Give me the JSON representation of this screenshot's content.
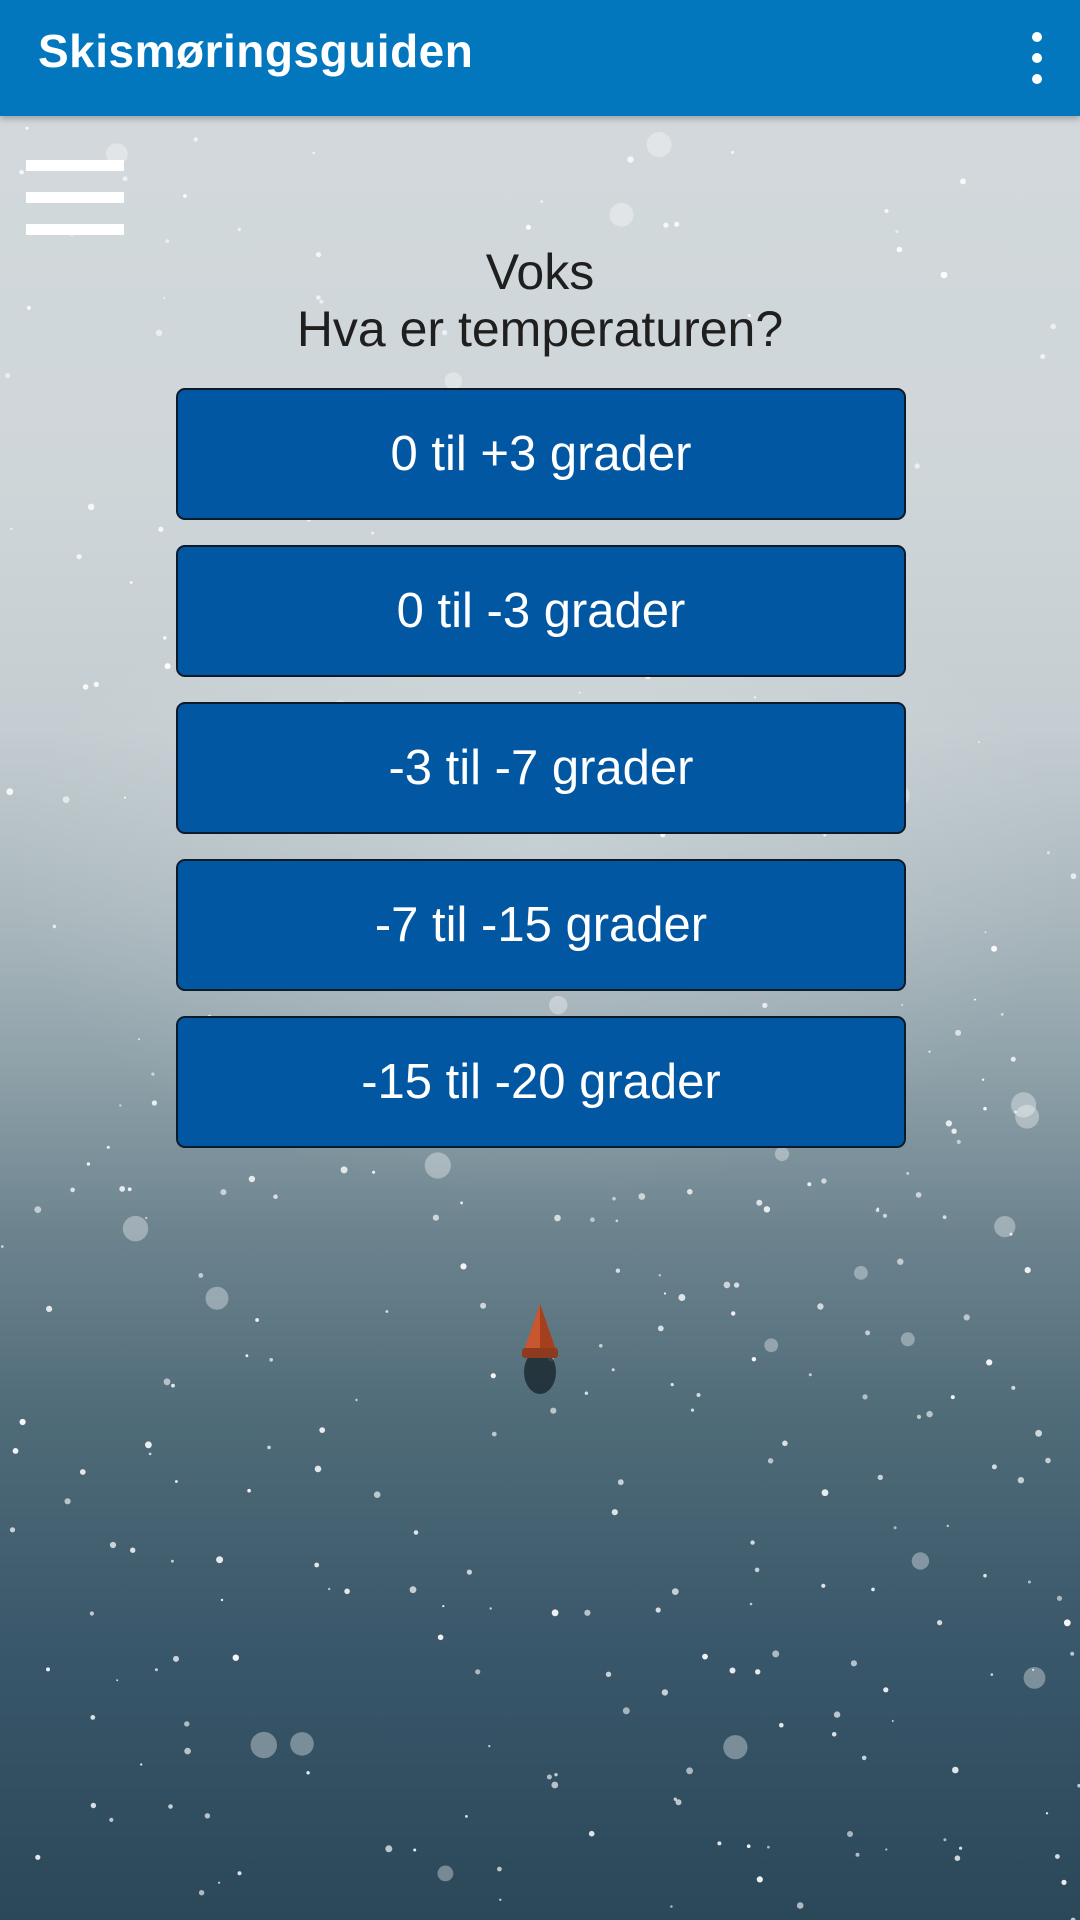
{
  "app_bar": {
    "title": "Skismøringsguiden",
    "overflow_icon": "more-vert-icon",
    "color": "#0277bd"
  },
  "nav": {
    "menu_icon": "hamburger-menu-icon"
  },
  "question": {
    "title": "Voks",
    "subtitle": "Hva er temperaturen?"
  },
  "options": [
    {
      "label": "0 til +3 grader"
    },
    {
      "label": "0 til -3 grader"
    },
    {
      "label": "-3 til -7 grader"
    },
    {
      "label": "-7 til -15 grader"
    },
    {
      "label": "-15 til -20 grader"
    }
  ],
  "theme": {
    "button_color": "#0257a3"
  }
}
